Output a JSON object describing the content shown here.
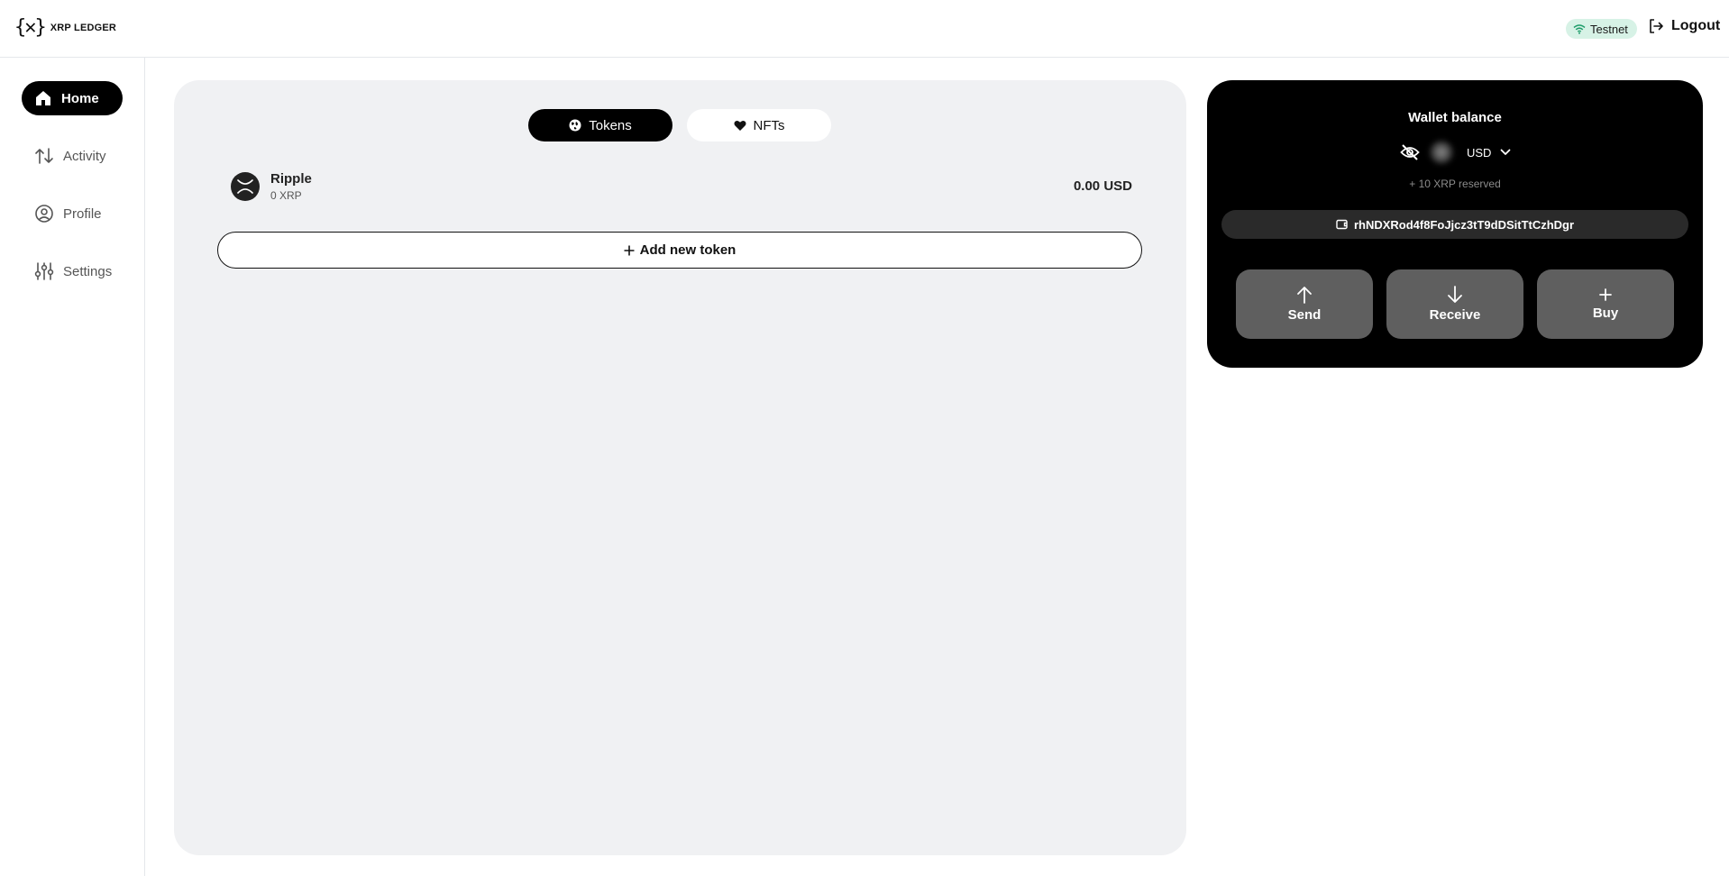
{
  "header": {
    "logo_text": "XRP LEDGER",
    "network_label": "Testnet",
    "logout_label": "Logout"
  },
  "sidebar": {
    "items": [
      {
        "label": "Home",
        "icon": "home-icon",
        "active": true
      },
      {
        "label": "Activity",
        "icon": "activity-icon",
        "active": false
      },
      {
        "label": "Profile",
        "icon": "profile-icon",
        "active": false
      },
      {
        "label": "Settings",
        "icon": "settings-icon",
        "active": false
      }
    ]
  },
  "main": {
    "tabs": [
      {
        "label": "Tokens",
        "icon": "globe-icon",
        "active": true
      },
      {
        "label": "NFTs",
        "icon": "heart-icon",
        "active": false
      }
    ],
    "tokens": [
      {
        "name": "Ripple",
        "amount": "0 XRP",
        "value": "0.00 USD",
        "icon": "xrp-icon"
      }
    ],
    "add_token_label": "Add new token"
  },
  "wallet": {
    "title": "Wallet balance",
    "currency": "USD",
    "reserved": "+ 10 XRP reserved",
    "address": "rhNDXRod4f8FoJjcz3tT9dDSitTtCzhDgr",
    "actions": [
      {
        "label": "Send",
        "icon": "arrow-up-icon"
      },
      {
        "label": "Receive",
        "icon": "arrow-down-icon"
      },
      {
        "label": "Buy",
        "icon": "plus-icon"
      }
    ]
  },
  "colors": {
    "accent": "#000000",
    "panel_bg": "#f0f1f3",
    "badge_bg": "#d7f2e6",
    "action_bg": "#5f5f5f"
  }
}
